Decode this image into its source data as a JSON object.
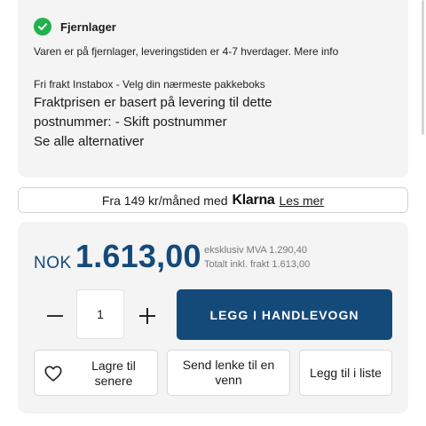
{
  "stock": {
    "title": "Fjernlager",
    "description": "Varen er på fjernlager, leveringstiden er 4-7 hverdager.",
    "more_info": "Mere info",
    "free_shipping": "Fri frakt Instabox - Velg din nærmeste pakkeboks",
    "freight_text": "Fraktprisen er basert på levering til dette postnummer: -",
    "change_postal": "Skift postnummer",
    "see_alternatives": "Se alle alternativer",
    "status_color": "#22b14c"
  },
  "klarna": {
    "prefix": "Fra 149 kr/måned med",
    "logo": "Klarna",
    "read_more": "Les mer"
  },
  "price": {
    "currency": "NOK",
    "amount": "1.613,00",
    "excl_vat": "eksklusiv MVA 1.290,40",
    "total_incl_freight": "Totalt inkl. frakt 1.613,00",
    "color": "#144a7a"
  },
  "cart": {
    "quantity": "1",
    "add_to_cart": "LEGG I HANDLEVOGN",
    "button_color": "#144a7a"
  },
  "actions": {
    "save_later": "Lagre til senere",
    "send_link": "Send lenke til en venn",
    "add_to_list": "Legg til i liste"
  },
  "icons": {
    "status": "check-circle-icon",
    "minus": "minus-icon",
    "plus": "plus-icon",
    "heart": "heart-icon"
  }
}
